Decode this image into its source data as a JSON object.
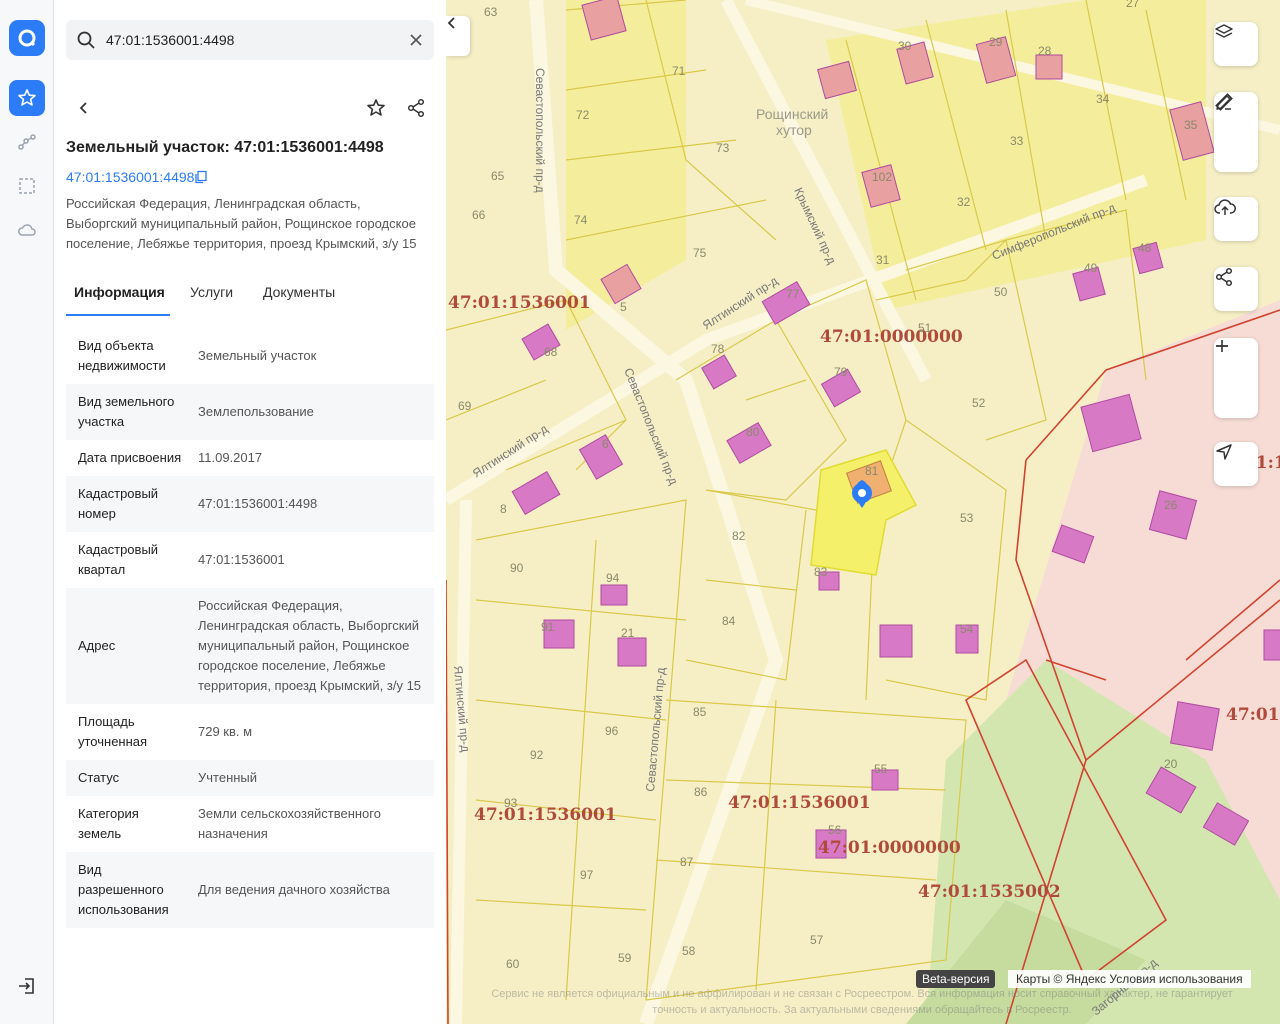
{
  "search": {
    "value": "47:01:1536001:4498"
  },
  "object": {
    "title": "Земельный участок: 47:01:1536001:4498",
    "cadastral_link": "47:01:1536001:4498",
    "address": "Российская Федерация, Ленинградская область, Выборгский муниципальный район, Рощинское городское поселение, Лебяжье территория, проезд Крымский, з/у 15"
  },
  "tabs": [
    "Информация",
    "Услуги",
    "Документы"
  ],
  "info_rows": [
    {
      "key": "Вид объекта недвижимости",
      "value": "Земельный участок"
    },
    {
      "key": "Вид земельного участка",
      "value": "Землепользование"
    },
    {
      "key": "Дата присвоения",
      "value": "11.09.2017"
    },
    {
      "key": "Кадастровый номер",
      "value": "47:01:1536001:4498"
    },
    {
      "key": "Кадастровый квартал",
      "value": "47:01:1536001"
    },
    {
      "key": "Адрес",
      "value": "Российская Федерация, Ленинградская область, Выборгский муниципальный район, Рощинское городское поселение, Лебяжье территория, проезд Крымский, з/у 15"
    },
    {
      "key": "Площадь уточненная",
      "value": "729 кв. м"
    },
    {
      "key": "Статус",
      "value": "Учтенный"
    },
    {
      "key": "Категория земель",
      "value": "Земли сельскохозяйственного назначения"
    },
    {
      "key": "Вид разрешенного использования",
      "value": "Для ведения дачного хозяйства"
    }
  ],
  "map": {
    "cadastral_labels": [
      "47:01:1536001",
      "47:01:0000000",
      "47:01:1536001",
      "47:01:1536001",
      "47:01:0000000",
      "47:01:1535002",
      "47:01:1",
      "47:01:"
    ],
    "streets": [
      "Севастопольский пр-д",
      "Крымский пр-д",
      "Симферопольский пр-д",
      "Ялтинский пр-д",
      "Ялтинский пр-д",
      "Севастопольский пр-д",
      "Ялтинский пр-д",
      "Севастопольский пр-д",
      "Загорный пр-д"
    ],
    "place": [
      "Рощинский",
      "хутор"
    ],
    "plots": [
      "63",
      "72",
      "71",
      "73",
      "65",
      "66",
      "74",
      "75",
      "5",
      "69",
      "68",
      "78",
      "77",
      "79",
      "80",
      "6",
      "8",
      "81",
      "82",
      "83",
      "84",
      "90",
      "94",
      "91",
      "21",
      "92",
      "96",
      "93",
      "97",
      "85",
      "86",
      "87",
      "55",
      "56",
      "58",
      "57",
      "59",
      "60",
      "53",
      "54",
      "52",
      "50",
      "51",
      "31",
      "32",
      "33",
      "34",
      "35",
      "29",
      "28",
      "30",
      "102",
      "49",
      "48",
      "27",
      "26",
      "20"
    ],
    "beta": "Beta-версия",
    "attribution": "Карты © Яндекс   Условия использования",
    "disclaimer": "Сервис не является официальным и не аффилирован и не связан с Росреестром. Вся информация носит справочный характер, не гарантирует точность и актуальность. За актуальными сведениями обращайтесь в Росреестр."
  },
  "colors": {
    "accent": "#2b7cf6",
    "plot_fill": "#f6efc6",
    "plot_border": "#d9c84a",
    "selected_plot": "#f4f06a",
    "building": "#d879c6",
    "red_border": "#d0432f",
    "forest": "#d3e6b0"
  }
}
